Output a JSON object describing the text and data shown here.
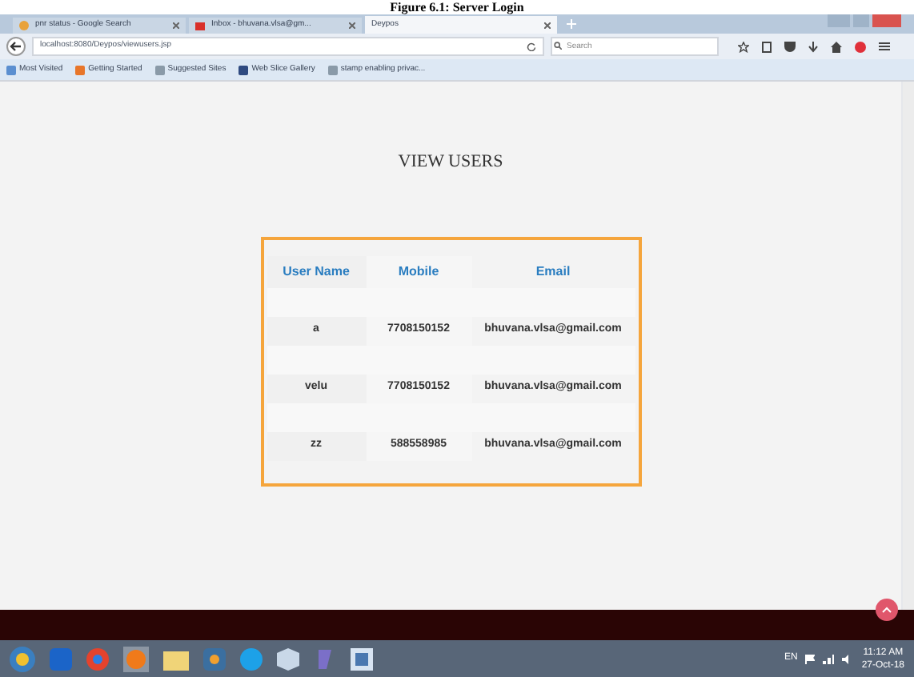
{
  "caption": "Figure 6.1: Server Login",
  "tabs": [
    {
      "label": "pnr status - Google Search",
      "selected": false
    },
    {
      "label": "Inbox - bhuvana.vlsa@gm...",
      "selected": false
    },
    {
      "label": "Deypos",
      "selected": true
    }
  ],
  "address_bar": {
    "url": "localhost:8080/Deypos/viewusers.jsp"
  },
  "search": {
    "placeholder": "Search"
  },
  "bookmarks": [
    "Most Visited",
    "Getting Started",
    "Suggested Sites",
    "Web Slice Gallery",
    "stamp enabling privac..."
  ],
  "page": {
    "heading": "VIEW USERS",
    "table": {
      "columns": [
        "User Name",
        "Mobile",
        "Email"
      ],
      "rows": [
        [
          "a",
          "7708150152",
          "bhuvana.vlsa@gmail.com"
        ],
        [
          "velu",
          "7708150152",
          "bhuvana.vlsa@gmail.com"
        ],
        [
          "zz",
          "588558985",
          "bhuvana.vlsa@gmail.com"
        ]
      ]
    }
  },
  "taskbar": {
    "language": "EN",
    "time": "11:12 AM",
    "date": "27-Oct-18"
  }
}
